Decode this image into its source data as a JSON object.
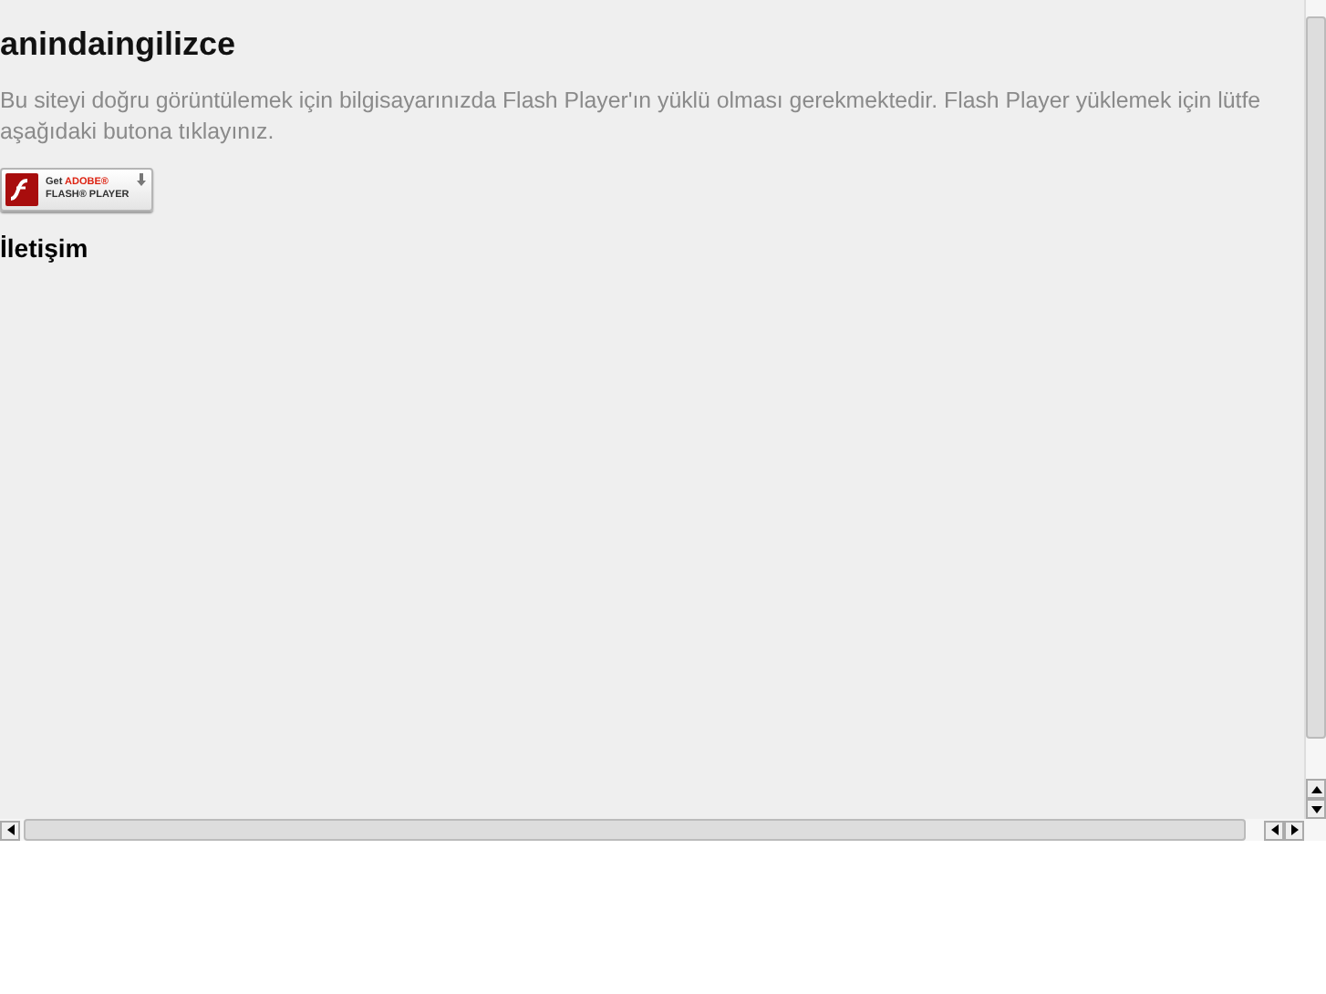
{
  "heading": "anindaingilizce",
  "notice_lines": [
    "Bu siteyi doğru görüntülemek için bilgisayarınızda Flash Player'ın yüklü olması gerekmektedir. Flash Player yüklemek için lütfe",
    "aşağıdaki butona tıklayınız."
  ],
  "flash_badge": {
    "line_1_prefix": "Get",
    "line_1_brand": "ADOBE®",
    "line_2": "FLASH® PLAYER"
  },
  "contact_heading": "İletişim"
}
